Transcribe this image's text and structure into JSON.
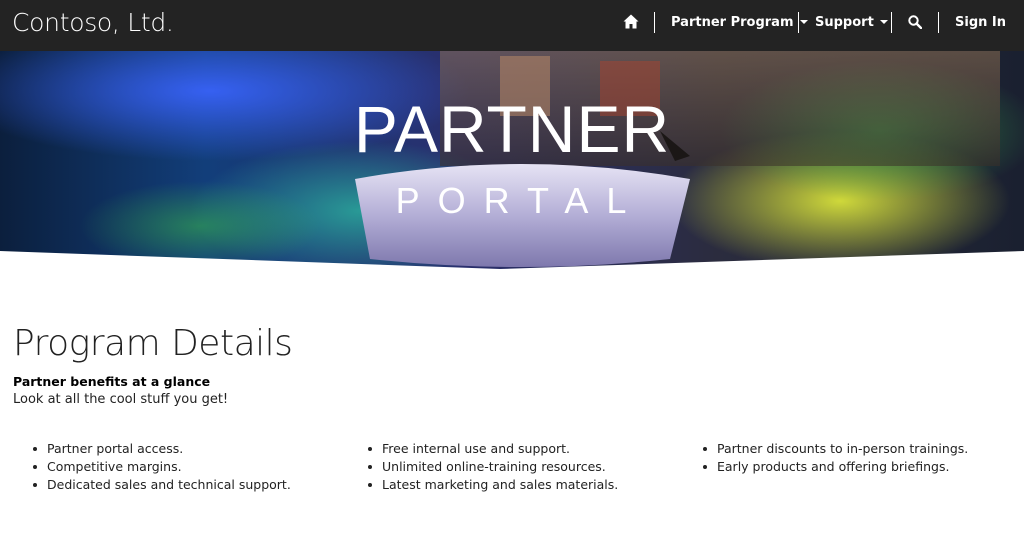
{
  "brand": "Contoso, Ltd.",
  "nav": {
    "home_icon": "home-icon",
    "partner_program": "Partner Program",
    "support": "Support",
    "search_icon": "search-icon",
    "sign_in": "Sign In"
  },
  "hero": {
    "title_line1": "PARTNER",
    "title_line2": "PORTAL"
  },
  "main": {
    "title": "Program Details",
    "subtitle": "Partner benefits at a glance",
    "description": "Look at all the cool stuff you get!",
    "columns": [
      [
        "Partner portal access.",
        "Competitive margins.",
        "Dedicated sales and technical support."
      ],
      [
        "Free internal use and support.",
        "Unlimited online-training resources.",
        "Latest marketing and sales materials."
      ],
      [
        "Partner discounts to in-person trainings.",
        "Early products and offering briefings."
      ]
    ]
  },
  "colors": {
    "navbar": "#232323",
    "text": "#222222"
  }
}
